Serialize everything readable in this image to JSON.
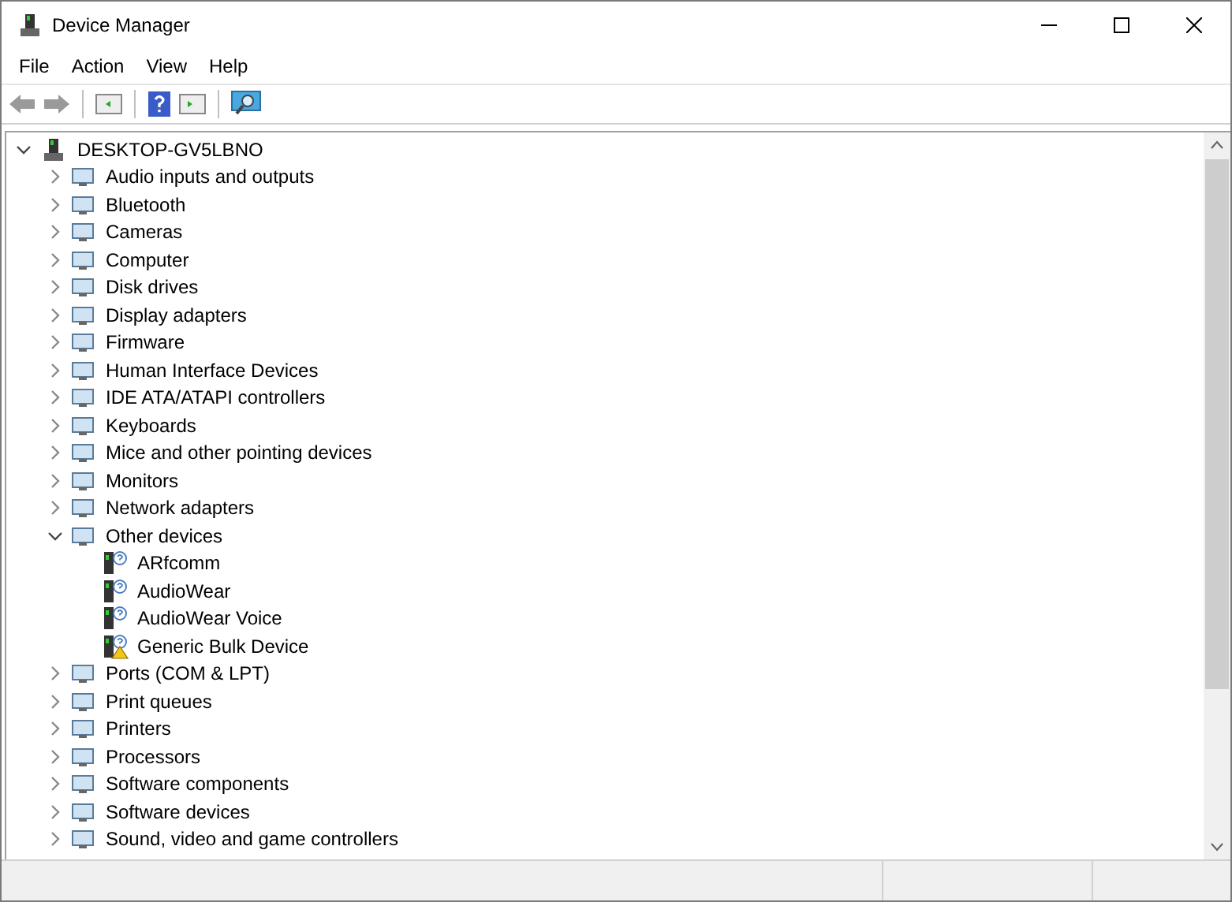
{
  "window": {
    "title": "Device Manager"
  },
  "menu": [
    "File",
    "Action",
    "View",
    "Help"
  ],
  "tree": {
    "label": "DESKTOP-GV5LBNO",
    "expanded": true,
    "children": [
      {
        "label": "Audio inputs and outputs",
        "expanded": false
      },
      {
        "label": "Bluetooth",
        "expanded": false
      },
      {
        "label": "Cameras",
        "expanded": false
      },
      {
        "label": "Computer",
        "expanded": false
      },
      {
        "label": "Disk drives",
        "expanded": false
      },
      {
        "label": "Display adapters",
        "expanded": false
      },
      {
        "label": "Firmware",
        "expanded": false
      },
      {
        "label": "Human Interface Devices",
        "expanded": false
      },
      {
        "label": "IDE ATA/ATAPI controllers",
        "expanded": false
      },
      {
        "label": "Keyboards",
        "expanded": false
      },
      {
        "label": "Mice and other pointing devices",
        "expanded": false
      },
      {
        "label": "Monitors",
        "expanded": false
      },
      {
        "label": "Network adapters",
        "expanded": false
      },
      {
        "label": "Other devices",
        "expanded": true,
        "children": [
          {
            "label": "ARfcomm",
            "warning": false
          },
          {
            "label": "AudioWear",
            "warning": false
          },
          {
            "label": "AudioWear Voice",
            "warning": false
          },
          {
            "label": "Generic Bulk Device",
            "warning": true
          }
        ]
      },
      {
        "label": "Ports (COM & LPT)",
        "expanded": false
      },
      {
        "label": "Print queues",
        "expanded": false
      },
      {
        "label": "Printers",
        "expanded": false
      },
      {
        "label": "Processors",
        "expanded": false
      },
      {
        "label": "Software components",
        "expanded": false
      },
      {
        "label": "Software devices",
        "expanded": false
      },
      {
        "label": "Sound, video and game controllers",
        "expanded": false
      }
    ]
  }
}
